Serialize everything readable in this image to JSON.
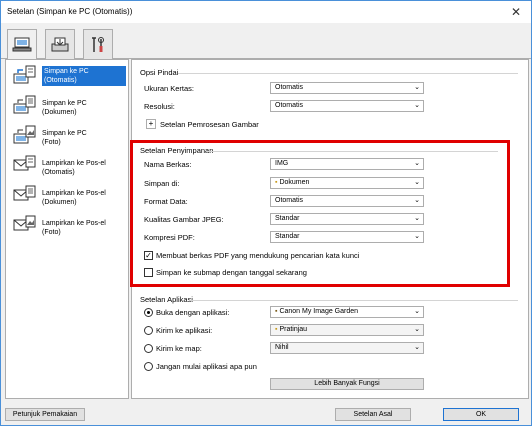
{
  "window": {
    "title": "Setelan (Simpan ke PC (Otomatis))",
    "close_icon": "close-icon"
  },
  "tabs": [
    {
      "icon": "scan-from-computer-icon"
    },
    {
      "icon": "scan-from-operation-panel-icon"
    },
    {
      "icon": "general-settings-icon"
    }
  ],
  "sidebar": {
    "items": [
      {
        "line1": "Simpan ke PC",
        "line2": "(Otomatis)",
        "selected": true
      },
      {
        "line1": "Simpan ke PC",
        "line2": "(Dokumen)"
      },
      {
        "line1": "Simpan ke PC",
        "line2": "(Foto)"
      },
      {
        "line1": "Lampirkan ke Pos-el",
        "line2": "(Otomatis)"
      },
      {
        "line1": "Lampirkan ke Pos-el",
        "line2": "(Dokumen)"
      },
      {
        "line1": "Lampirkan ke Pos-el",
        "line2": "(Foto)"
      }
    ]
  },
  "scan_options": {
    "title": "Opsi Pindai",
    "paper_size_label": "Ukuran Kertas:",
    "paper_size_value": "Otomatis",
    "resolution_label": "Resolusi:",
    "resolution_value": "Otomatis",
    "image_processing_label": "Setelan Pemrosesan Gambar"
  },
  "save_settings": {
    "title": "Setelan Penyimpanan",
    "file_name_label": "Nama Berkas:",
    "file_name_value": "IMG",
    "save_in_label": "Simpan di:",
    "save_in_value": "Dokumen",
    "data_format_label": "Format Data:",
    "data_format_value": "Otomatis",
    "jpeg_quality_label": "Kualitas Gambar JPEG:",
    "jpeg_quality_value": "Standar",
    "pdf_compression_label": "Kompresi PDF:",
    "pdf_compression_value": "Standar",
    "keyword_pdf_label": "Membuat berkas PDF yang mendukung pencarian kata kunci",
    "keyword_pdf_checked": true,
    "subfolder_label": "Simpan ke submap dengan tanggal sekarang",
    "subfolder_checked": false
  },
  "app_settings": {
    "title": "Setelan Aplikasi",
    "open_with_label": "Buka dengan aplikasi:",
    "open_with_value": "Canon My Image Garden",
    "send_to_app_label": "Kirim ke aplikasi:",
    "send_to_app_value": "Pratinjau",
    "send_to_folder_label": "Kirim ke map:",
    "send_to_folder_value": "Nihil",
    "do_not_start_label": "Jangan mulai aplikasi apa pun",
    "more_functions_label": "Lebih Banyak Fungsi"
  },
  "footer": {
    "instructions_label": "Petunjuk Pemakaian",
    "defaults_label": "Setelan Asal",
    "ok_label": "OK"
  },
  "colors": {
    "accent": "#1e73d2",
    "highlight_border": "#e00000"
  }
}
